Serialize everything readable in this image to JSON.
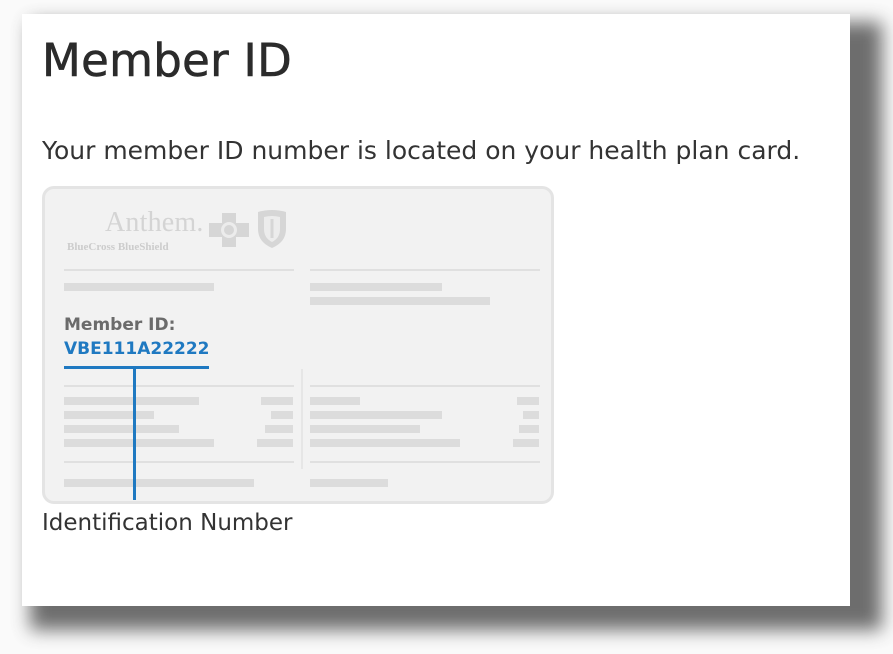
{
  "page": {
    "title": "Member ID",
    "intro": "Your member ID number is located on your health plan card.",
    "callout_label": "Identification Number"
  },
  "card": {
    "brand_name": "Anthem.",
    "brand_subtitle": "BlueCross BlueShield",
    "member_id_label": "Member ID:",
    "member_id_value": "VBE111A22222",
    "icons": [
      "blue-cross-icon",
      "blue-shield-icon"
    ]
  },
  "colors": {
    "accent": "#1f79c1",
    "text": "#333333",
    "card_background": "#f2f2f2",
    "placeholder": "#dcdcdc"
  }
}
